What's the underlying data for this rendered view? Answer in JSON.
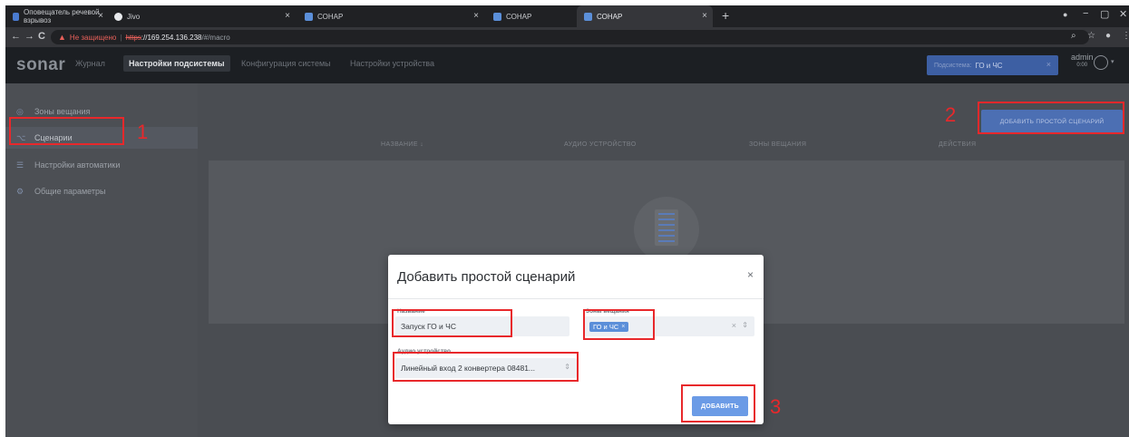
{
  "browser": {
    "tabs": [
      {
        "title": "Оповещатель речевой взрывоз",
        "fav_color": "#4a7bd0"
      },
      {
        "title": "Jivo",
        "fav_color": "#e8eaed"
      },
      {
        "title": "СОНАР",
        "fav_color": "#5b8fd9"
      },
      {
        "title": "СОНАР",
        "fav_color": "#5b8fd9"
      },
      {
        "title": "СОНАР",
        "fav_color": "#5b8fd9"
      }
    ],
    "tab_close": "×",
    "new_tab": "+",
    "window_controls": {
      "minimize": "−",
      "maximize": "▢",
      "close": "✕"
    },
    "nav": {
      "back": "←",
      "forward": "→",
      "reload": "C"
    },
    "address": {
      "warning_icon": "▲",
      "security_label": "Не защищено",
      "scheme": "https",
      "host": "://169.254.136.238",
      "path": "/#/macro"
    },
    "toolbar_icons": {
      "zoom": "⌕",
      "bookmark": "☆",
      "profile": "●",
      "menu": "⋮"
    }
  },
  "app": {
    "logo": "sonar",
    "nav": [
      {
        "label": "Журнал",
        "active": false
      },
      {
        "label": "Настройки подсистемы",
        "active": true
      },
      {
        "label": "Конфигурация системы",
        "active": false
      },
      {
        "label": "Настройки устройства",
        "active": false
      }
    ],
    "subsystem": {
      "label": "Подсистема:",
      "value": "ГО и ЧС",
      "clear": "×"
    },
    "user": {
      "name": "admin",
      "time": "0:00",
      "caret": "▾"
    }
  },
  "sidebar": {
    "items": [
      {
        "label": "Зоны вещания",
        "icon": "◎",
        "active": false
      },
      {
        "label": "Сценарии",
        "icon": "⌥",
        "active": true
      },
      {
        "label": "Настройки автоматики",
        "icon": "☰",
        "active": false
      },
      {
        "label": "Общие параметры",
        "icon": "⚙",
        "active": false
      }
    ]
  },
  "content": {
    "add_button": "ДОБАВИТЬ ПРОСТОЙ СЦЕНАРИЙ",
    "columns": [
      "НАЗВАНИЕ ↓",
      "АУДИО УСТРОЙСТВО",
      "ЗОНЫ ВЕЩАНИЯ",
      "ДЕЙСТВИЯ"
    ]
  },
  "modal": {
    "title": "Добавить простой сценарий",
    "close": "×",
    "name_label": "Название",
    "name_value": "Запуск ГО и ЧС",
    "zones_label": "Зоны вещания",
    "zones_chip": "ГО и ЧС",
    "chip_remove": "×",
    "clear": "×",
    "caret": "⇕",
    "audio_label": "Аудио устройство",
    "audio_value": "Линейный вход 2 конвертера 08481...",
    "submit": "ДОБАВИТЬ"
  },
  "annotations": {
    "one": "1",
    "two": "2",
    "three": "3",
    "color": "#e8282b"
  }
}
